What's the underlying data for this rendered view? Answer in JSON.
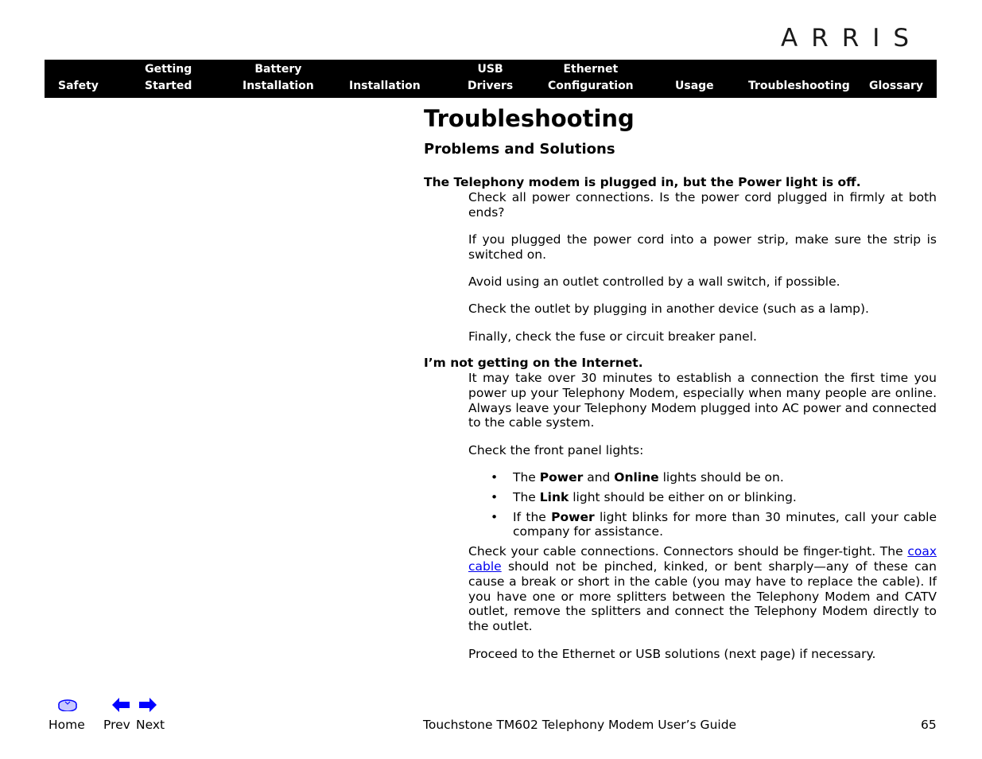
{
  "logo": "ARRIS",
  "nav": [
    "Safety",
    "Getting\nStarted",
    "Battery\nInstallation",
    "Installation",
    "USB\nDrivers",
    "Ethernet\nConfiguration",
    "Usage",
    "Troubleshooting",
    "Glossary"
  ],
  "title": "Troubleshooting",
  "subtitle": "Problems and Solutions",
  "q1": {
    "heading": "The Telephony modem is plugged in, but the Power light is off.",
    "p": [
      "Check all power connections. Is the power cord plugged in firmly at both ends?",
      "If you plugged the power cord into a power strip, make sure the strip is switched on.",
      "Avoid using an outlet controlled by a wall switch, if possible.",
      "Check the outlet by plugging in another device (such as a lamp).",
      "Finally, check the fuse or circuit breaker panel."
    ]
  },
  "q2": {
    "heading": "I’m not getting on the Internet.",
    "p1": "It may take over 30 minutes to establish a connection the first time you power up your Telephony Modem, especially when many people are online. Always leave your Telephony Modem plugged into AC power and connected to the cable system.",
    "p2": "Check the front panel lights:",
    "b1": {
      "a": "The ",
      "b": "Power",
      "c": " and ",
      "d": "Online",
      "e": " lights should be on."
    },
    "b2": {
      "a": "The ",
      "b": "Link",
      "c": " light should be either on or blinking."
    },
    "b3": {
      "a": "If the ",
      "b": "Power",
      "c": " light blinks for more than 30 minutes, call your cable company for assistance."
    },
    "p3a": "Check your cable connections. Connectors should be finger-tight. The ",
    "p3link": "coax cable",
    "p3b": " should not be pinched, kinked, or bent sharply—any of these can cause a break or short in the cable (you may have to replace the cable). If you have one or more splitters between the Telephony Modem and CATV outlet, remove the splitters and connect the Telephony Modem directly to the outlet.",
    "p4": "Proceed to the Ethernet or USB solutions (next page) if necessary."
  },
  "footer": {
    "home": "Home",
    "prev": "Prev",
    "next": "Next",
    "guide": "Touchstone TM602 Telephony Modem User’s Guide",
    "page": "65"
  },
  "colors": {
    "nav_bg": "#000000",
    "link": "#0000ee",
    "icon": "#0000ff"
  }
}
